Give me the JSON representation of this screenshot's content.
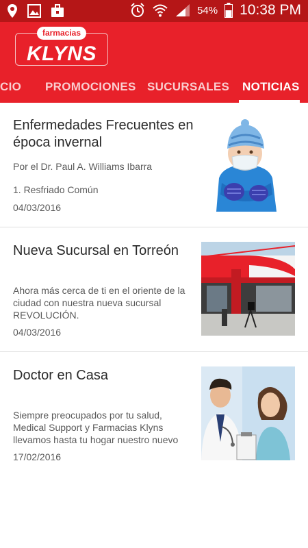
{
  "status_bar": {
    "battery_percent": "54%",
    "time": "10:38 PM",
    "icons": [
      "location-icon",
      "image-icon",
      "briefcase-icon",
      "alarm-icon",
      "wifi-icon",
      "signal-icon",
      "battery-icon"
    ]
  },
  "app": {
    "logo_small": "farmacias",
    "logo_brand": "KLYNS",
    "colors": {
      "primary": "#e8212a",
      "status_bar": "#b51617"
    }
  },
  "tabs": [
    {
      "label": "CIO",
      "active": false
    },
    {
      "label": "PROMOCIONES",
      "active": false
    },
    {
      "label": "SUCURSALES",
      "active": false
    },
    {
      "label": "NOTICIAS",
      "active": true
    }
  ],
  "news": [
    {
      "title": "Enfermedades Frecuentes en época invernal",
      "subtitle": "Por el Dr. Paul A. Williams Ibarra",
      "excerpt": "1. Resfriado Común",
      "date": "04/03/2016",
      "image": "child-with-mask"
    },
    {
      "title": "Nueva Sucursal en Torreón",
      "subtitle": "",
      "excerpt": "Ahora más cerca de ti en el oriente de la ciudad con nuestra nueva sucursal REVOLUCIÓN.",
      "date": "04/03/2016",
      "image": "klyns-storefront"
    },
    {
      "title": "Doctor en Casa",
      "subtitle": "",
      "excerpt": "Siempre preocupados por tu salud, Medical Support y Farmacias Klyns llevamos hasta tu hogar nuestro nuevo",
      "date": "17/02/2016",
      "image": "doctor-and-patient"
    }
  ]
}
